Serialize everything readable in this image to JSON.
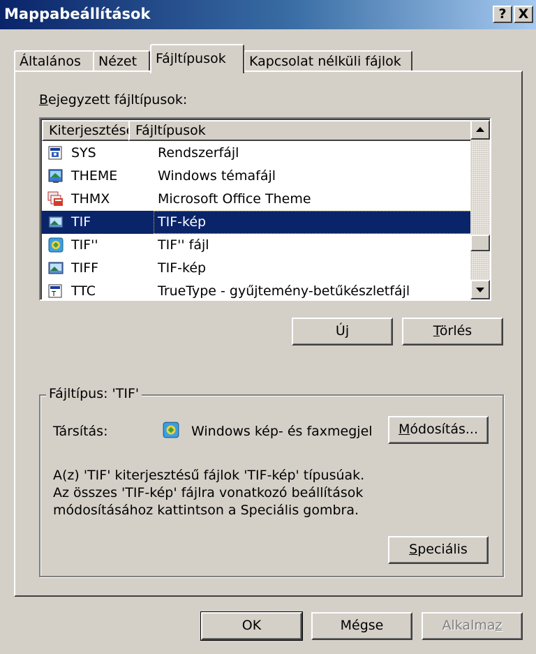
{
  "window": {
    "title": "Mappabeállítások",
    "help_label": "?",
    "close_label": "X"
  },
  "tabs": [
    {
      "label": "Általános",
      "active": false
    },
    {
      "label": "Nézet",
      "active": false
    },
    {
      "label": "Fájltípusok",
      "active": true
    },
    {
      "label": "Kapcsolat nélküli fájlok",
      "active": false
    }
  ],
  "filetypes": {
    "label_prefix": "B",
    "label_rest": "ejegyzett fájltípusok:",
    "columns": [
      "Kiterjesztések",
      "Fájltípusok"
    ],
    "rows": [
      {
        "ext": "SYS",
        "type": "Rendszerfájl",
        "icon": "system-file-icon"
      },
      {
        "ext": "THEME",
        "type": "Windows témafájl",
        "icon": "theme-file-icon"
      },
      {
        "ext": "THMX",
        "type": "Microsoft Office Theme",
        "icon": "office-theme-icon"
      },
      {
        "ext": "TIF",
        "type": "TIF-kép",
        "icon": "image-file-icon",
        "selected": true
      },
      {
        "ext": "TIF''",
        "type": "TIF'' fájl",
        "icon": "fax-viewer-icon"
      },
      {
        "ext": "TIFF",
        "type": "TIF-kép",
        "icon": "image-file-icon"
      },
      {
        "ext": "TTC",
        "type": "TrueType - gyűjtemény-betűkészletfájl",
        "icon": "font-file-icon"
      }
    ]
  },
  "buttons": {
    "new": "Új",
    "delete_u": "T",
    "delete_rest": "örlés",
    "change_u": "M",
    "change_rest": "ódosítás...",
    "advanced_u": "S",
    "advanced_rest": "peciális",
    "ok": "OK",
    "cancel": "Mégse",
    "apply_main": "Alkalma",
    "apply_u": "z"
  },
  "details": {
    "group_title": "Fájltípus: 'TIF'",
    "opens_with_label": "Társítás:",
    "opens_with_app": "Windows kép- és faxmegjel",
    "description_lines": [
      "A(z) 'TIF' kiterjesztésű fájlok 'TIF-kép' típusúak.",
      "Az összes 'TIF-kép' fájlra vonatkozó beállítások",
      "módosításához kattintson a Speciális gombra."
    ]
  },
  "colors": {
    "selection": "#0a246a",
    "face": "#d4d0c8"
  }
}
